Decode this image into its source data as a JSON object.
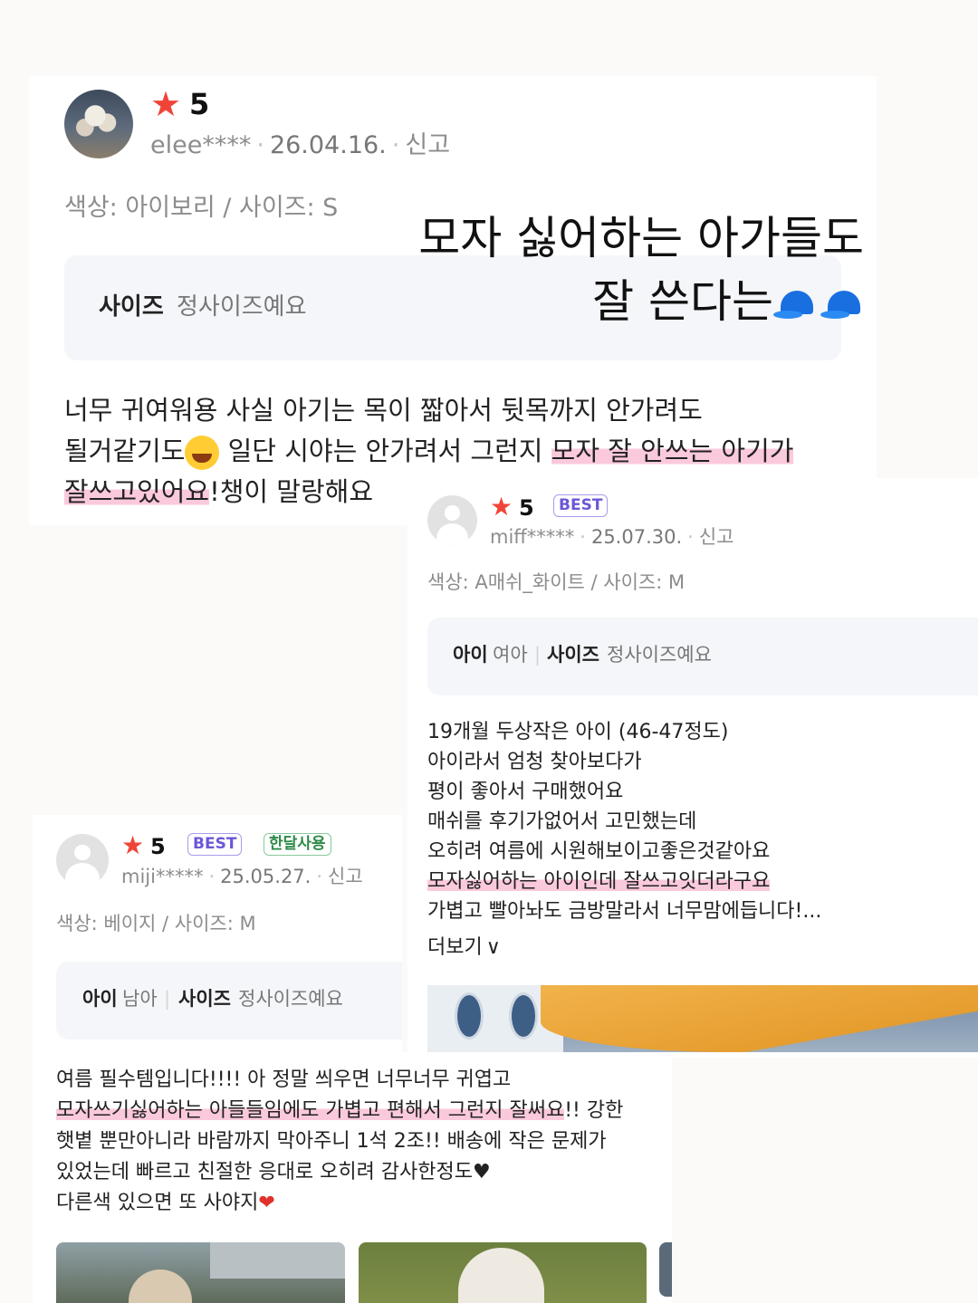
{
  "overlay": {
    "line1": "모자 싫어하는 아가들도",
    "line2": "잘 쓴다는"
  },
  "reviews": [
    {
      "rating": "5",
      "user": "elee****",
      "date": "26.04.16.",
      "report": "신고",
      "options": "색상: 아이보리 / 사이즈: S",
      "size_key": "사이즈",
      "size_value": "정사이즈예요",
      "text_line1": "너무 귀여워용 사실 아기는 목이 짧아서 뒷목까지 안가려도",
      "text_line2a": "될거같기도",
      "text_line2b": " 일단 시야는 안가려서 그런지 ",
      "text_line2c": "모자 잘 안쓰는 아기가",
      "text_line3a": "잘쓰고있어요",
      "text_line3b": "!챙이 말랑해요"
    },
    {
      "rating": "5",
      "badge": "BEST",
      "user": "miff*****",
      "date": "25.07.30.",
      "report": "신고",
      "options": "색상: A매쉬_화이트 / 사이즈: M",
      "kid_key": "아이",
      "kid_value": "여아",
      "size_key": "사이즈",
      "size_value": "정사이즈예요",
      "lines": [
        "19개월 두상작은 아이 (46-47정도)",
        "아이라서 엄청 찾아보다가",
        "평이 좋아서 구매했어요",
        "매쉬를 후기가없어서 고민했는데",
        "오히려 여름에 시원해보이고좋은것같아요"
      ],
      "highlight_line": "모자싫어하는 아이인데 잘쓰고잇더라구요",
      "last_line": "가볍고 빨아놔도 금방말라서 너무맘에듭니다!...",
      "more": "더보기"
    },
    {
      "rating": "5",
      "badge": "BEST",
      "badge2": "한달사용",
      "user": "miji*****",
      "date": "25.05.27.",
      "report": "신고",
      "options": "색상: 베이지 / 사이즈: M",
      "kid_key": "아이",
      "kid_value": "남아",
      "size_key": "사이즈",
      "size_value": "정사이즈예요",
      "line1": "여름 필수템입니다!!!! 아 정말 씌우면 너무너무 귀엽고",
      "line2a": "모자쓰기싫어하는 아들들임에도 가볍고 편해서 그런지 잘써요",
      "line2b": "!! 강한",
      "line3": "햇볕 뿐만아니라 바람까지 막아주니 1석 2조!! 배송에 작은 문제가",
      "line4": "있었는데 빠르고 친절한 응대로 오히려 감사한정도♥",
      "line5": "다른색 있으면 또 사야지"
    }
  ],
  "icons": {
    "star": "★",
    "chevron": "∨",
    "separator": "|",
    "dot": "·",
    "heart": "❤"
  },
  "colors": {
    "star": "#f04438",
    "highlight": "#fbc9dc",
    "best": "#6b57d6",
    "month": "#2c8a46"
  }
}
